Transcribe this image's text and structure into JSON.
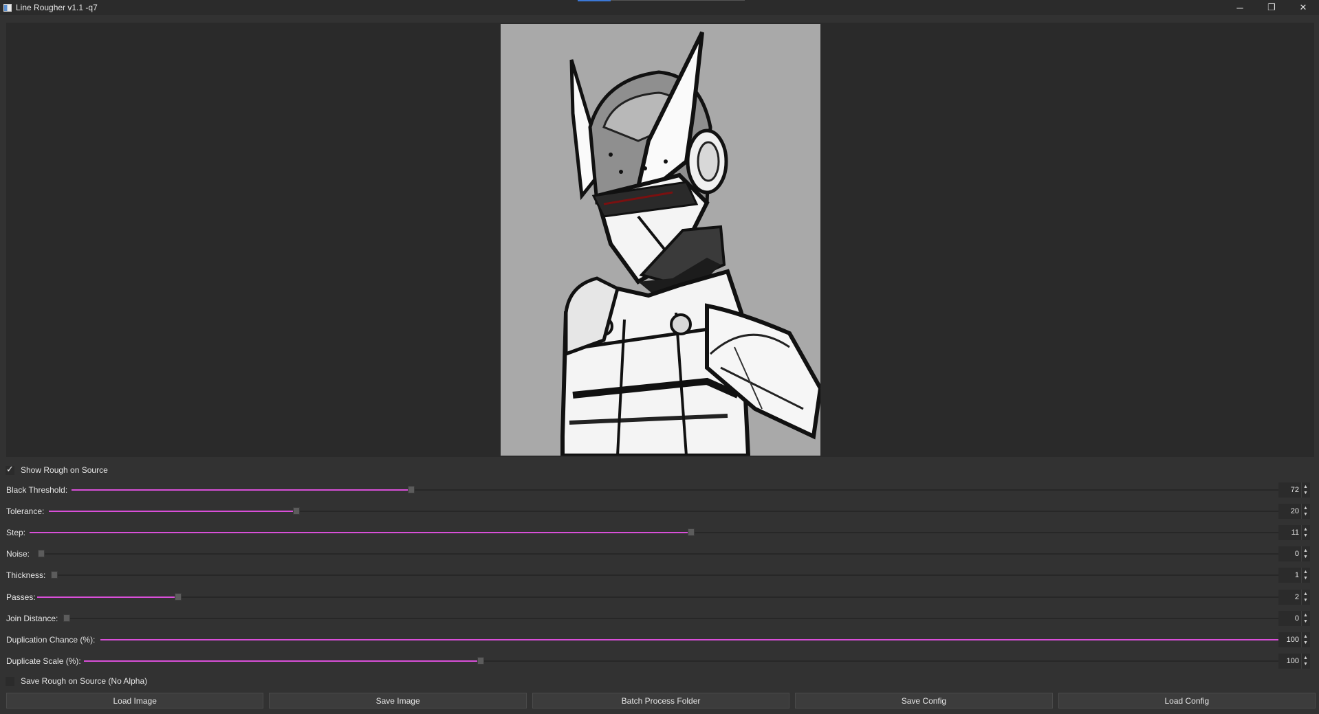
{
  "window": {
    "title": "Line Rougher v1.1 -q7",
    "controls": {
      "minimize": "─",
      "restore": "❐",
      "close": "✕"
    }
  },
  "options": {
    "show_rough_on_source": {
      "label": "Show Rough on Source",
      "checked": true
    },
    "save_rough_on_source": {
      "label": "Save Rough on Source (No Alpha)",
      "checked": false
    }
  },
  "sliders": [
    {
      "label": "Black Threshold:",
      "value": "72",
      "fraction": 0.28
    },
    {
      "label": "Tolerance:",
      "value": "20",
      "fraction": 0.2
    },
    {
      "label": "Step:",
      "value": "11",
      "fraction": 0.527
    },
    {
      "label": "Noise:",
      "value": "0",
      "fraction": 0.0
    },
    {
      "label": "Thickness:",
      "value": "1",
      "fraction": 0.0
    },
    {
      "label": "Passes:",
      "value": "2",
      "fraction": 0.113
    },
    {
      "label": "Join Distance:",
      "value": "0",
      "fraction": 0.0
    },
    {
      "label": "Duplication Chance (%):",
      "value": "100",
      "fraction": 1.0
    },
    {
      "label": "Duplicate Scale (%):",
      "value": "100",
      "fraction": 0.33
    }
  ],
  "buttons": {
    "load_image": "Load Image",
    "save_image": "Save Image",
    "batch_process": "Batch Process Folder",
    "save_config": "Save Config",
    "load_config": "Load Config"
  },
  "colors": {
    "accent": "#d94fd9",
    "background": "#323232",
    "preview_background": "#2a2a2a",
    "canvas_gray": "#a9a9a9"
  }
}
